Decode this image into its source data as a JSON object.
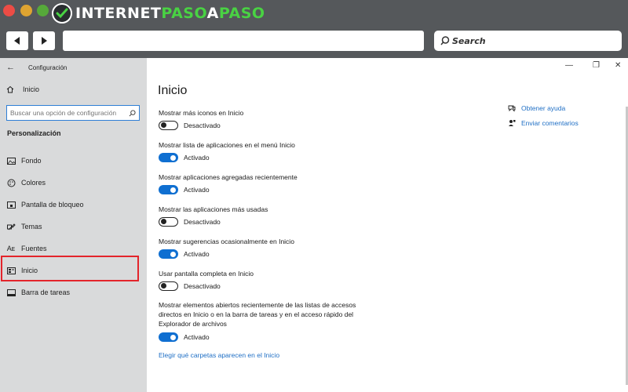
{
  "browser": {
    "logo_part1": "INTERNET",
    "logo_part2": "PASO",
    "logo_part3": "A",
    "logo_part4": "PASO",
    "search_label": "Search",
    "colors": {
      "chrome": "#55585b",
      "logo_green": "#49d243"
    }
  },
  "sidebar": {
    "window_title": "Configuración",
    "home_label": "Inicio",
    "search_placeholder": "Buscar una opción de configuración",
    "section_title": "Personalización",
    "items": [
      {
        "label": "Fondo",
        "icon": "image-icon"
      },
      {
        "label": "Colores",
        "icon": "palette-icon"
      },
      {
        "label": "Pantalla de bloqueo",
        "icon": "lock-screen-icon"
      },
      {
        "label": "Temas",
        "icon": "brush-icon"
      },
      {
        "label": "Fuentes",
        "icon": "font-icon"
      },
      {
        "label": "Inicio",
        "icon": "start-icon"
      },
      {
        "label": "Barra de tareas",
        "icon": "taskbar-icon"
      }
    ]
  },
  "main": {
    "title": "Inicio",
    "options": [
      {
        "label": "Mostrar más iconos en Inicio",
        "state": "Desactivado",
        "on": false
      },
      {
        "label": "Mostrar lista de aplicaciones en el menú Inicio",
        "state": "Activado",
        "on": true
      },
      {
        "label": "Mostrar aplicaciones agregadas recientemente",
        "state": "Activado",
        "on": true
      },
      {
        "label": "Mostrar las aplicaciones más usadas",
        "state": "Desactivado",
        "on": false
      },
      {
        "label": "Mostrar sugerencias ocasionalmente en Inicio",
        "state": "Activado",
        "on": true
      },
      {
        "label": "Usar pantalla completa en Inicio",
        "state": "Desactivado",
        "on": false
      },
      {
        "label": "Mostrar elementos abiertos recientemente de las listas de accesos directos en Inicio o en la barra de tareas y en el acceso rápido del Explorador de archivos",
        "state": "Activado",
        "on": true
      }
    ],
    "folders_link": "Elegir qué carpetas aparecen en el Inicio",
    "help_link": "Obtener ayuda",
    "feedback_link": "Enviar comentarios",
    "colors": {
      "toggle_on": "#0f6fd1",
      "link": "#1f6fc5",
      "highlight": "#e3242b"
    }
  }
}
